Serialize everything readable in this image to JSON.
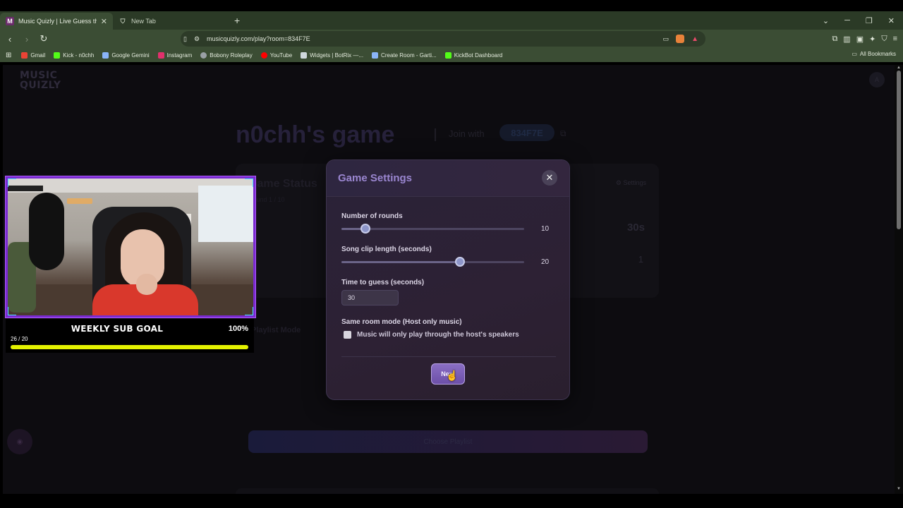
{
  "browser": {
    "tabs": [
      {
        "title": "Music Quizly | Live Guess the So...",
        "favicon": "M",
        "active": true
      },
      {
        "title": "New Tab",
        "active": false
      }
    ],
    "url": "musicquizly.com/play?room=834F7E",
    "bookmarks": [
      {
        "label": "Gmail",
        "color": "#ea4335"
      },
      {
        "label": "Kick - n0chh",
        "color": "#53fc18"
      },
      {
        "label": "Google Gemini",
        "color": "#8ab4f8"
      },
      {
        "label": "Instagram",
        "color": "#e1306c"
      },
      {
        "label": "Bobony Roleplay",
        "color": "#9aa0a6"
      },
      {
        "label": "YouTube",
        "color": "#ff0000"
      },
      {
        "label": "Widgets | BotRix —...",
        "color": "#cfd8dc"
      },
      {
        "label": "Create Room - Garti...",
        "color": "#8ab4f8"
      },
      {
        "label": "KickBot Dashboard",
        "color": "#53fc18"
      }
    ],
    "all_bookmarks": "All Bookmarks"
  },
  "background_page": {
    "logo_line1": "MUSIC",
    "logo_line2": "QUIZLY",
    "avatar_letter": "A",
    "game_title": "n0chh's game",
    "join_label": "Join with",
    "room_code": "834F7E",
    "status_title": "Game Status",
    "round_text": "Round 1 / 10",
    "settings_label": "Settings",
    "time_value": "30s",
    "players_value": "1",
    "playlist_mode": "Playlist Mode",
    "choose_playlist": "Choose Playlist"
  },
  "modal": {
    "title": "Game Settings",
    "rounds": {
      "label": "Number of rounds",
      "value": "10",
      "fraction": 0.13
    },
    "clip_length": {
      "label": "Song clip length (seconds)",
      "value": "20",
      "fraction": 0.65
    },
    "guess_time": {
      "label": "Time to guess (seconds)",
      "value": "30"
    },
    "same_room": {
      "label": "Same room mode (Host only music)",
      "checkbox_label": "Music will only play through the host's speakers",
      "checked": false
    },
    "next_label": "Next"
  },
  "overlay": {
    "goal_title": "WEEKLY SUB GOAL",
    "goal_percent": "100%",
    "goal_count": "26 / 20",
    "goal_fraction": 1.0,
    "accent": "#e4f200",
    "frame_color": "#7a2bd0"
  }
}
